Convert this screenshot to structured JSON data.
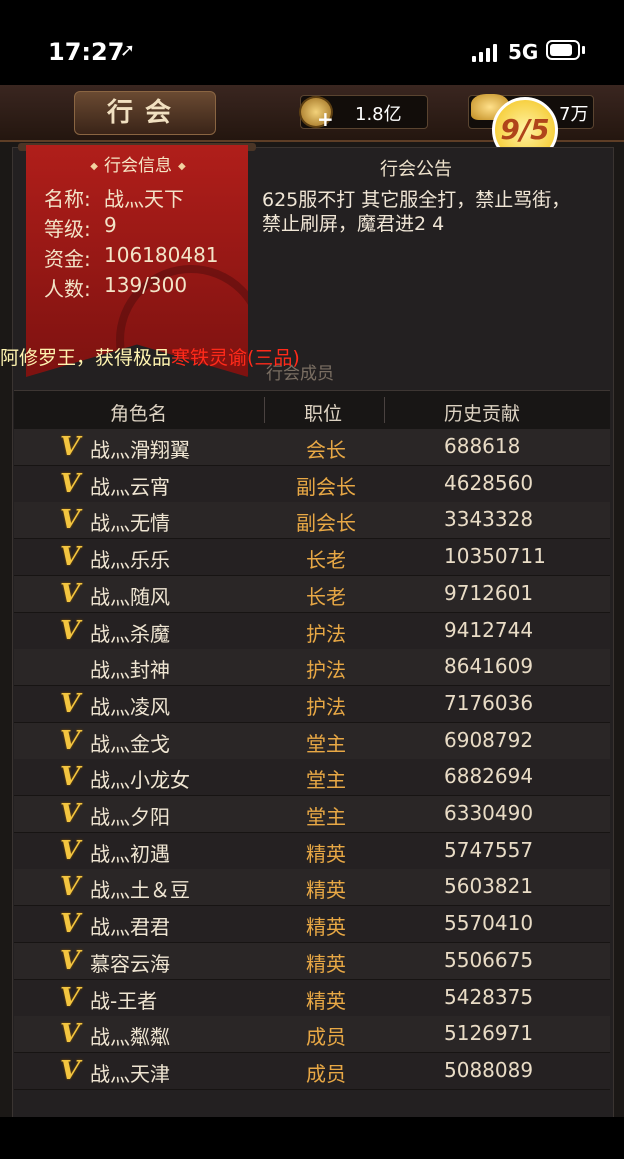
{
  "status_bar": {
    "time": "17:27",
    "network": "5G"
  },
  "header": {
    "title": "行会",
    "gold": "1.8亿",
    "ingot": "7万",
    "badge": "9/5"
  },
  "guild_info": {
    "title": "行会信息",
    "fields": [
      {
        "label": "名称:",
        "value": "战灬天下"
      },
      {
        "label": "等级:",
        "value": "9"
      },
      {
        "label": "资金:",
        "value": "106180481"
      },
      {
        "label": "人数:",
        "value": "139/300"
      }
    ]
  },
  "notice": {
    "title": "行会公告",
    "text": "625服不打 其它服全打，禁止骂街，禁止刷屏，魔君进2 4"
  },
  "ticker": {
    "prefix": "阿修罗王，获得极品",
    "item": "寒铁灵谕(三品)"
  },
  "members_section": {
    "title": "行会成员"
  },
  "table": {
    "headers": {
      "name": "角色名",
      "role": "职位",
      "contribution": "历史贡献"
    },
    "rows": [
      {
        "v": "V",
        "name": "战灬滑翔翼",
        "role": "会长",
        "contribution": "688618"
      },
      {
        "v": "V",
        "name": "战灬云宵",
        "role": "副会长",
        "contribution": "4628560"
      },
      {
        "v": "V",
        "name": "战灬无情",
        "role": "副会长",
        "contribution": "3343328"
      },
      {
        "v": "V",
        "name": "战灬乐乐",
        "role": "长老",
        "contribution": "10350711"
      },
      {
        "v": "V",
        "name": "战灬随风",
        "role": "长老",
        "contribution": "9712601"
      },
      {
        "v": "V",
        "name": "战灬杀魔",
        "role": "护法",
        "contribution": "9412744"
      },
      {
        "v": "",
        "name": "战灬封神",
        "role": "护法",
        "contribution": "8641609"
      },
      {
        "v": "V",
        "name": "战灬凌风",
        "role": "护法",
        "contribution": "7176036"
      },
      {
        "v": "V",
        "name": "战灬金戈",
        "role": "堂主",
        "contribution": "6908792"
      },
      {
        "v": "V",
        "name": "战灬小龙女",
        "role": "堂主",
        "contribution": "6882694"
      },
      {
        "v": "V",
        "name": "战灬夕阳",
        "role": "堂主",
        "contribution": "6330490"
      },
      {
        "v": "V",
        "name": "战灬初遇",
        "role": "精英",
        "contribution": "5747557"
      },
      {
        "v": "V",
        "name": "战灬土＆豆",
        "role": "精英",
        "contribution": "5603821"
      },
      {
        "v": "V",
        "name": "战灬君君",
        "role": "精英",
        "contribution": "5570410"
      },
      {
        "v": "V",
        "name": "慕容云海",
        "role": "精英",
        "contribution": "5506675"
      },
      {
        "v": "V",
        "name": "战-王者",
        "role": "精英",
        "contribution": "5428375"
      },
      {
        "v": "V",
        "name": "战灬粼粼",
        "role": "成员",
        "contribution": "5126971"
      },
      {
        "v": "V",
        "name": "战灬天津",
        "role": "成员",
        "contribution": "5088089"
      }
    ]
  }
}
